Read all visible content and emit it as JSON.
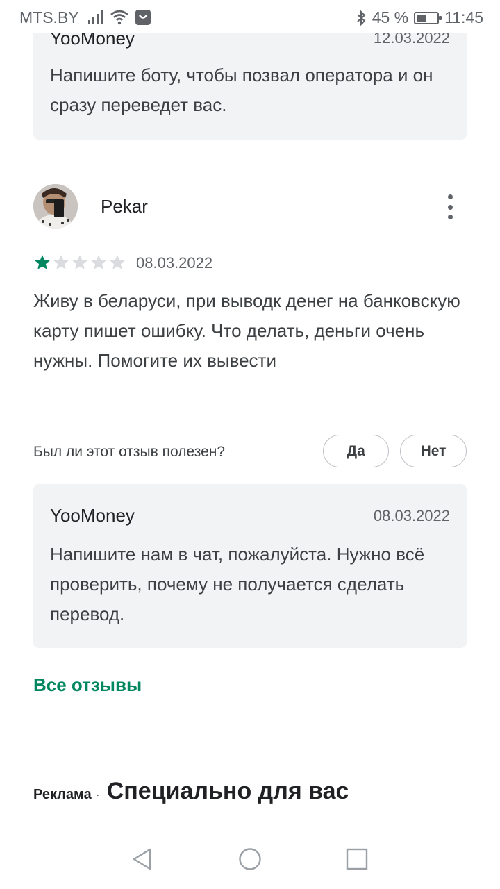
{
  "status_bar": {
    "carrier": "MTS.BY",
    "battery": "45 %",
    "time": "11:45",
    "battery_level": 0.45
  },
  "top_reply": {
    "developer": "YooMoney",
    "date": "12.03.2022",
    "text": "Напишите боту, чтобы позвал оператора и он сразу переведет вас."
  },
  "review": {
    "author": "Pekar",
    "rating": 1,
    "max_rating": 5,
    "date": "08.03.2022",
    "text": "Живу в беларуси, при выводк денег на банковскую карту пишет ошибку. Что делать, деньги очень нужны. Помогите их вывести",
    "helpful_question": "Был ли этот отзыв полезен?",
    "yes_label": "Да",
    "no_label": "Нет"
  },
  "reply": {
    "developer": "YooMoney",
    "date": "08.03.2022",
    "text": "Напишите нам в чат, пожалуйста. Нужно всё проверить, почему не получается сделать перевод."
  },
  "all_reviews_label": "Все отзывы",
  "ads": {
    "label": "Реклама",
    "separator": "·",
    "title": "Специально для вас"
  },
  "colors": {
    "accent_green": "#01875f",
    "card_bg": "#f1f3f4",
    "star_empty": "#dadce0"
  },
  "icons": [
    "signal-icon",
    "wifi-icon",
    "notification-icon",
    "bluetooth-icon",
    "battery-icon",
    "more-vert-icon",
    "star-icon",
    "nav-back-icon",
    "nav-home-icon",
    "nav-recents-icon"
  ]
}
